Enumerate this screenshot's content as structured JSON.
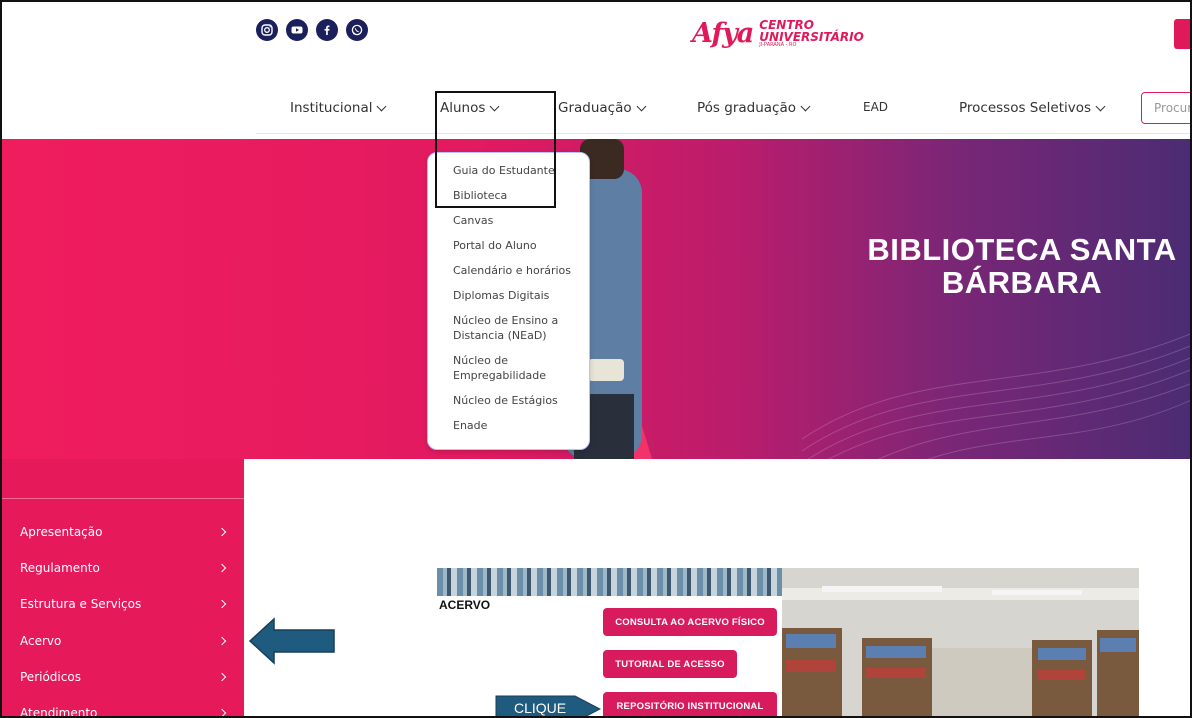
{
  "header": {
    "social_icons": [
      "instagram-icon",
      "youtube-icon",
      "facebook-icon",
      "whatsapp-icon"
    ],
    "logo": {
      "mark": "Afya",
      "line1": "CENTRO",
      "line2": "UNIVERSITÁRIO",
      "line3": "JI-PARANÁ - RO"
    },
    "brand_color": "#e0195a"
  },
  "nav": {
    "items": [
      {
        "label": "Institucional",
        "has_chevron": true
      },
      {
        "label": "Alunos",
        "has_chevron": true
      },
      {
        "label": "Graduação",
        "has_chevron": true
      },
      {
        "label": "Pós graduação",
        "has_chevron": true
      },
      {
        "label": "EAD",
        "has_chevron": false
      },
      {
        "label": "Processos Seletivos",
        "has_chevron": true
      }
    ],
    "search_placeholder": "Procura"
  },
  "dropdown": {
    "items": [
      "Guia do Estudante",
      "Biblioteca",
      "Canvas",
      "Portal do Aluno",
      "Calendário e horários",
      "Diplomas Digitais",
      "Núcleo de Ensino a Distancia (NEaD)",
      "Núcleo de Empregabilidade",
      "Núcleo de Estágios",
      "Enade"
    ]
  },
  "hero": {
    "title_line1": "BIBLIOTECA SANTA",
    "title_line2": "BÁRBARA"
  },
  "sidebar": {
    "items": [
      "Apresentação",
      "Regulamento",
      "Estrutura e Serviços",
      "Acervo",
      "Periódicos",
      "Atendimento"
    ]
  },
  "acervo": {
    "title": "ACERVO",
    "buttons": [
      "CONSULTA AO ACERVO FÍSICO",
      "TUTORIAL DE ACESSO",
      "REPOSITÓRIO INSTITUCIONAL"
    ],
    "callout": "CLIQUE",
    "arrow_color": "#1f5b7e"
  }
}
